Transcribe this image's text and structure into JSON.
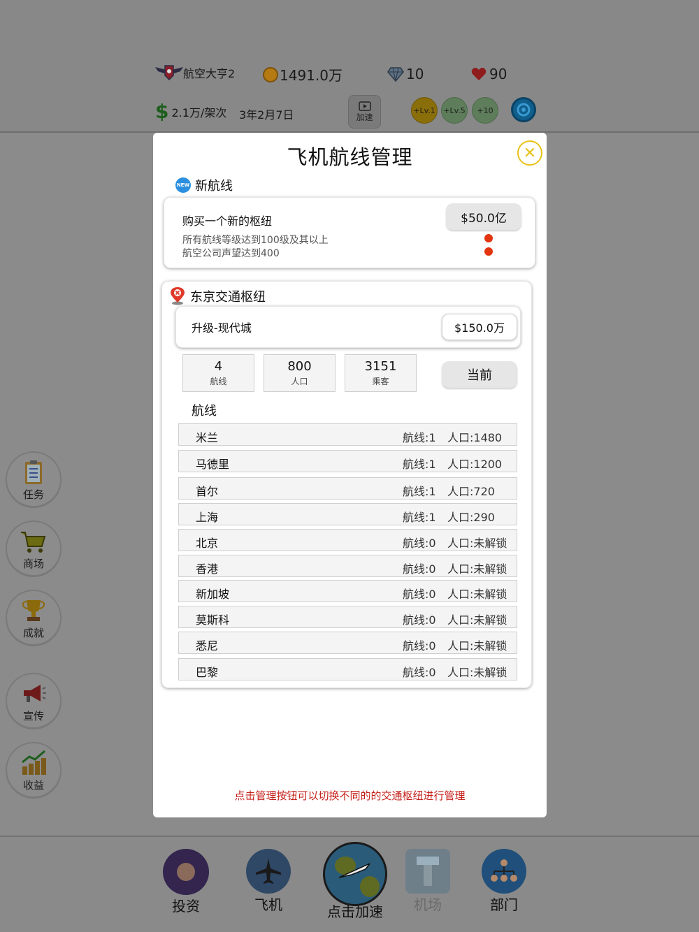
{
  "topbar": {
    "company_name": "航空大亨2",
    "coins": "1491.0万",
    "gems": "10",
    "lives": "90",
    "rate": "2.1万/架次",
    "date": "3年2月7日",
    "speed_label": "加速",
    "boosts": [
      "+Lv.1",
      "+Lv.5",
      "+10"
    ]
  },
  "sidebar": {
    "items": [
      {
        "label": "任务",
        "icon": "task-clipboard-icon"
      },
      {
        "label": "商场",
        "icon": "shopping-cart-icon"
      },
      {
        "label": "成就",
        "icon": "trophy-icon"
      },
      {
        "label": "宣传",
        "icon": "megaphone-icon"
      },
      {
        "label": "收益",
        "icon": "income-chart-icon"
      }
    ]
  },
  "bottomnav": {
    "items": [
      {
        "label": "投资",
        "icon": "invest-touch-icon"
      },
      {
        "label": "飞机",
        "icon": "airplane-icon"
      },
      {
        "label": "点击加速",
        "icon": "globe-plane-icon"
      },
      {
        "label": "机场",
        "icon": "airport-tower-icon"
      },
      {
        "label": "部门",
        "icon": "department-org-icon"
      }
    ]
  },
  "modal": {
    "title": "飞机航线管理",
    "new_route": {
      "header": "新航线",
      "badge": "NEW",
      "buy_label": "购买一个新的枢纽",
      "price": "$50.0亿",
      "requirements": [
        "所有航线等级达到100级及其以上",
        "航空公司声望达到400"
      ]
    },
    "hub": {
      "name": "东京交通枢纽",
      "upgrade_label": "升级-现代城",
      "upgrade_price": "$150.0万",
      "stats": [
        {
          "value": "4",
          "label": "航线"
        },
        {
          "value": "800",
          "label": "人口"
        },
        {
          "value": "3151",
          "label": "乘客"
        }
      ],
      "current_label": "当前",
      "routes_title": "航线",
      "routes": [
        {
          "city": "米兰",
          "lines": "航线:1",
          "pop": "人口:1480"
        },
        {
          "city": "马德里",
          "lines": "航线:1",
          "pop": "人口:1200"
        },
        {
          "city": "首尔",
          "lines": "航线:1",
          "pop": "人口:720"
        },
        {
          "city": "上海",
          "lines": "航线:1",
          "pop": "人口:290"
        },
        {
          "city": "北京",
          "lines": "航线:0",
          "pop": "人口:未解锁"
        },
        {
          "city": "香港",
          "lines": "航线:0",
          "pop": "人口:未解锁"
        },
        {
          "city": "新加坡",
          "lines": "航线:0",
          "pop": "人口:未解锁"
        },
        {
          "city": "莫斯科",
          "lines": "航线:0",
          "pop": "人口:未解锁"
        },
        {
          "city": "悉尼",
          "lines": "航线:0",
          "pop": "人口:未解锁"
        },
        {
          "city": "巴黎",
          "lines": "航线:0",
          "pop": "人口:未解锁"
        }
      ]
    },
    "hint": "点击管理按钮可以切换不同的的交通枢纽进行管理"
  },
  "colors": {
    "hint_red": "#c5201a",
    "close_yellow": "#e8c21a",
    "status_dot": "#e33410"
  }
}
